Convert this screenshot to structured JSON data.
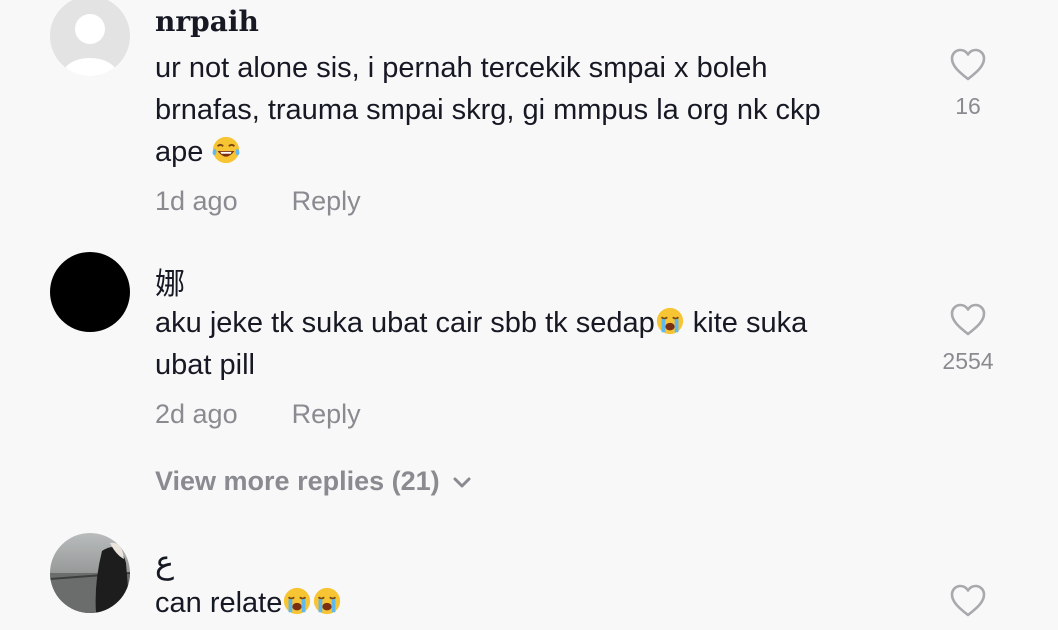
{
  "comments": [
    {
      "username": "nrpaih",
      "text_lines": [
        "ur not alone sis, i pernah tercekik smpai x boleh",
        "brnafas, trauma smpai skrg, gi mmpus la org nk ckp",
        "ape"
      ],
      "emoji": "face-with-tears-of-joy",
      "time": "1d ago",
      "reply_label": "Reply",
      "likes": "16"
    },
    {
      "username": "娜",
      "text_line1_before": "aku jeke tk suka ubat cair sbb tk sedap",
      "text_line1_after": " kite suka",
      "text_line2": "ubat pill",
      "emoji": "loudly-crying-face",
      "time": "2d ago",
      "reply_label": "Reply",
      "likes": "2554"
    },
    {
      "username": "ع",
      "text": "can relate",
      "emoji": "loudly-crying-face"
    }
  ],
  "view_more_label": "View more replies (21)"
}
